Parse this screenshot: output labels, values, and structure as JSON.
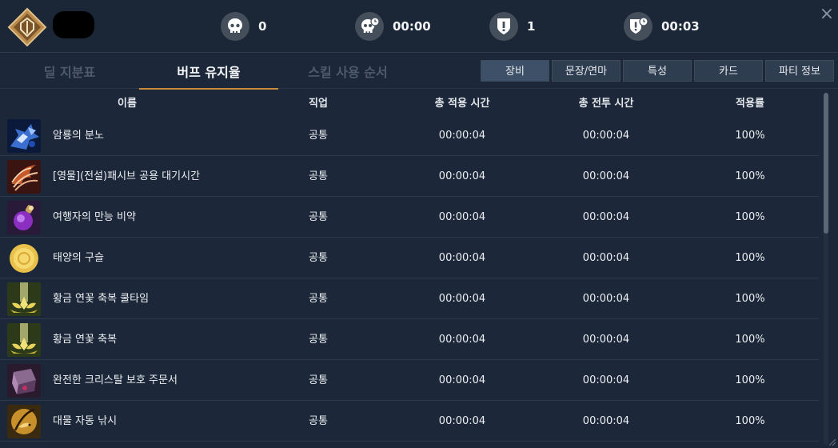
{
  "header": {
    "class_emblem": "class-emblem-icon",
    "name_redacted": true,
    "stats": [
      {
        "icon": "skull-icon",
        "value": "0"
      },
      {
        "icon": "skull-clock-icon",
        "value": "00:00"
      },
      {
        "icon": "shield-exclamation-icon",
        "value": "1"
      },
      {
        "icon": "shield-clock-icon",
        "value": "00:03"
      }
    ],
    "close_label": "×"
  },
  "tabs": [
    {
      "label": "딜 지분표",
      "active": false
    },
    {
      "label": "버프 유지율",
      "active": true
    },
    {
      "label": "스킬 사용 순서",
      "active": false
    }
  ],
  "subtabs": [
    {
      "label": "장비",
      "active": true
    },
    {
      "label": "문장/연마",
      "active": false
    },
    {
      "label": "특성",
      "active": false
    },
    {
      "label": "카드",
      "active": false
    },
    {
      "label": "파티 정보",
      "active": false
    }
  ],
  "table": {
    "columns": [
      "이름",
      "직업",
      "총 적용 시간",
      "총 전투 시간",
      "적용률"
    ],
    "rows": [
      {
        "icon": "dragon-rage-icon",
        "name": "암룡의 분노",
        "job": "공통",
        "apply": "00:00:04",
        "combat": "00:00:04",
        "rate": "100%"
      },
      {
        "icon": "legendary-passive-icon",
        "name": "[영물](전설)패시브 공용 대기시간",
        "job": "공통",
        "apply": "00:00:04",
        "combat": "00:00:04",
        "rate": "100%"
      },
      {
        "icon": "potion-icon",
        "name": "여행자의 만능 비약",
        "job": "공통",
        "apply": "00:00:04",
        "combat": "00:00:04",
        "rate": "100%"
      },
      {
        "icon": "sun-orb-icon",
        "name": "태양의 구슬",
        "job": "공통",
        "apply": "00:00:04",
        "combat": "00:00:04",
        "rate": "100%"
      },
      {
        "icon": "golden-lotus-icon",
        "name": "황금 연꽃 축복 쿨타임",
        "job": "공통",
        "apply": "00:00:04",
        "combat": "00:00:04",
        "rate": "100%"
      },
      {
        "icon": "golden-lotus-icon",
        "name": "황금 연꽃 축복",
        "job": "공통",
        "apply": "00:00:04",
        "combat": "00:00:04",
        "rate": "100%"
      },
      {
        "icon": "crystal-scroll-icon",
        "name": "완전한 크리스탈 보호 주문서",
        "job": "공통",
        "apply": "00:00:04",
        "combat": "00:00:04",
        "rate": "100%"
      },
      {
        "icon": "fishing-icon",
        "name": "대물 자동 낚시",
        "job": "공통",
        "apply": "00:00:04",
        "combat": "00:00:04",
        "rate": "100%"
      }
    ]
  }
}
